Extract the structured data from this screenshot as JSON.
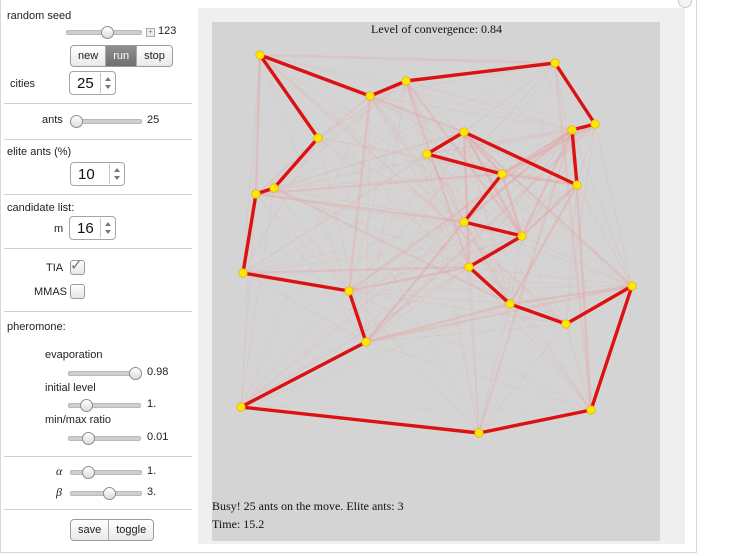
{
  "controls": {
    "random_seed_label": "random seed",
    "random_seed_value": "123",
    "random_seed_fraction": 0.55,
    "buttons": [
      "new",
      "run",
      "stop"
    ],
    "active_button": "run",
    "cities_label": "cities",
    "cities_value": "25",
    "ants_label": "ants",
    "ants_value": "25",
    "ants_fraction": 0.08,
    "elite_label": "elite ants (%)",
    "elite_value": "10",
    "candidate_label": "candidate list:",
    "candidate_m_label": "m",
    "candidate_value": "16",
    "tia_label": "TIA",
    "tia_checked": true,
    "mmas_label": "MMAS",
    "mmas_checked": false,
    "pheromone_label": "pheromone:",
    "evaporation_label": "evaporation",
    "evaporation_value": "0.98",
    "evaporation_fraction": 0.95,
    "initial_label": "initial level",
    "initial_value": "1.",
    "initial_fraction": 0.25,
    "minmax_label": "min/max ratio",
    "minmax_value": "0.01",
    "minmax_fraction": 0.28,
    "alpha_label": "α",
    "alpha_value": "1.",
    "alpha_fraction": 0.25,
    "beta_label": "β",
    "beta_value": "3.",
    "beta_fraction": 0.55,
    "bottom_buttons": [
      "save",
      "toggle"
    ]
  },
  "plot": {
    "title": "Level of convergence: 0.84",
    "status": "Busy! 25 ants on the move. Elite ants: 3",
    "time": "Time: 15.2"
  },
  "colors": {
    "tour": "#dd1111",
    "trail": "#e8a0a0",
    "city": "#ffe800",
    "city_outline": "#e8b800"
  }
}
